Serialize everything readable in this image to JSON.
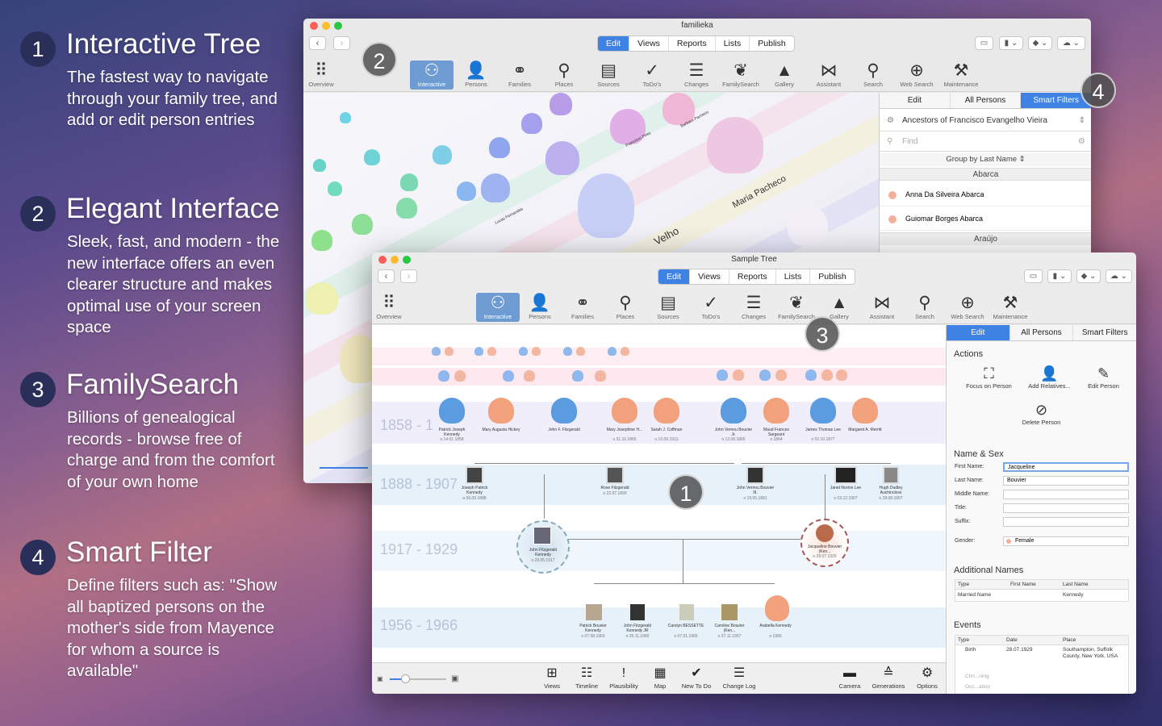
{
  "features": [
    {
      "num": "1",
      "title": "Interactive Tree",
      "desc": "The fastest way to navigate through your family tree, and add or edit person entries"
    },
    {
      "num": "2",
      "title": "Elegant Interface",
      "desc": "Sleek, fast, and modern - the new interface offers an even clearer structure and makes optimal use of your screen space"
    },
    {
      "num": "3",
      "title": "FamilySearch",
      "desc": "Billions of genealogical records - browse free of charge and from the comfort of your own home"
    },
    {
      "num": "4",
      "title": "Smart Filter",
      "desc": "Define filters such as: \"Show all baptized persons on the mother's side from Mayence for whom a source is available\""
    }
  ],
  "back_window": {
    "title": "familieka",
    "tabs": [
      "Edit",
      "Views",
      "Reports",
      "Lists",
      "Publish"
    ],
    "panel_tabs": [
      "Edit",
      "All Persons",
      "Smart Filters"
    ],
    "filter": "Ancestors of Francisco Evangelho Vieira",
    "find_placeholder": "Find",
    "group_by": "Group by Last Name ⇕",
    "groups": [
      {
        "name": "Abarca",
        "persons": [
          "Anna Da Silveira Abarca",
          "Guiomar Borges Abarca"
        ]
      },
      {
        "name": "Araújo",
        "persons": []
      }
    ],
    "tree_names": [
      "Maria Pacheco",
      "Velho",
      "Francisco Pires",
      "Barbara Pacheco",
      "Lucas Fernandes"
    ]
  },
  "front_window": {
    "title": "Sample Tree",
    "tabs": [
      "Edit",
      "Views",
      "Reports",
      "Lists",
      "Publish"
    ],
    "panel_tabs": [
      "Edit",
      "All Persons",
      "Smart Filters"
    ],
    "actions_title": "Actions",
    "actions": [
      "Focus on Person",
      "Add Relatives...",
      "Edit Person",
      "Delete Person"
    ],
    "name_sex_title": "Name & Sex",
    "fields": [
      {
        "label": "First Name:",
        "value": "Jacqueline"
      },
      {
        "label": "Last Name:",
        "value": "Bouvier"
      },
      {
        "label": "Middle Name:",
        "value": ""
      },
      {
        "label": "Title:",
        "value": ""
      },
      {
        "label": "Suffix:",
        "value": ""
      }
    ],
    "gender_label": "Gender:",
    "gender_value": "Female",
    "additional_names_title": "Additional Names",
    "an_headers": [
      "Type",
      "First Name",
      "Last Name"
    ],
    "an_row": [
      "Married Name",
      "",
      "Kennedy"
    ],
    "events_title": "Events",
    "ev_headers": [
      "Type",
      "Date",
      "Place"
    ],
    "ev_row": [
      "Birth",
      "28.07.1929",
      "Southampton, Suffolk County, New York, USA"
    ],
    "ev_more": [
      "Chri...ning",
      "Occ...ation"
    ],
    "eras": [
      "1858 - 1",
      "1888 - 1907",
      "1917 - 1929",
      "1956 - 1966"
    ],
    "gen3": [
      {
        "name": "Patrick Joseph Kennedy",
        "date": "o 14.01.1858"
      },
      {
        "name": "Mary Augusta Hickey",
        "date": ""
      },
      {
        "name": "John F. Fitzgerald",
        "date": ""
      },
      {
        "name": "Mary Josephine H...",
        "date": "o 31.10.1865"
      },
      {
        "name": "Sarah J. Coffman",
        "date": "o 10.09.1913"
      },
      {
        "name": "John Vernou Bouvier Jr.",
        "date": "o 12.08.1865"
      },
      {
        "name": "Maud Frances Sargeant",
        "date": "o 1864"
      },
      {
        "name": "James Thomas Lee",
        "date": "o 02.10.1877"
      },
      {
        "name": "Margaret A. Merritt",
        "date": ""
      }
    ],
    "gen2": [
      {
        "name": "Joseph Patrick Kennedy",
        "date": "o 06.09.1888"
      },
      {
        "name": "Rose Fitzgerald",
        "date": "o 22.07.1890"
      },
      {
        "name": "John Vernou Bouvier III.",
        "date": "o 19.05.1891"
      },
      {
        "name": "Janet Norton Lee",
        "date": "o 03.12.1907"
      },
      {
        "name": "Hugh Dudley Auchincloss",
        "date": "o 28.08.1897"
      }
    ],
    "gen1": [
      {
        "name": "John Fitzgerald Kennedy",
        "date": "o 29.05.1917"
      },
      {
        "name": "Jacqueline Bouvier (Ken...",
        "date": "o 28.07.1929"
      }
    ],
    "gen0": [
      {
        "name": "Patrick Bouvier Kennedy",
        "date": "o 07.08.1963"
      },
      {
        "name": "John Fitzgerald Kennedy JR",
        "date": "o 25.11.1960"
      },
      {
        "name": "Carolyn BESSETTE",
        "date": "o 07.01.1966"
      },
      {
        "name": "Caroline Bouvier (Ken...",
        "date": "o 27.11.1957"
      },
      {
        "name": "Arabella Kennedy",
        "date": "o 1956"
      }
    ],
    "bottom_left": [
      "Views",
      "Timeline",
      "Plausibility",
      "Map",
      "New To Do",
      "Change Log"
    ],
    "bottom_right": [
      "Camera",
      "Generations",
      "Options"
    ]
  },
  "toolbar": [
    "Overview",
    "Interactive",
    "Persons",
    "Families",
    "Places",
    "Sources",
    "ToDo's",
    "Changes",
    "FamilySearch",
    "Gallery",
    "Assistant",
    "Search",
    "Web Search",
    "Maintenance"
  ],
  "callouts": [
    "2",
    "4",
    "3",
    "1"
  ]
}
